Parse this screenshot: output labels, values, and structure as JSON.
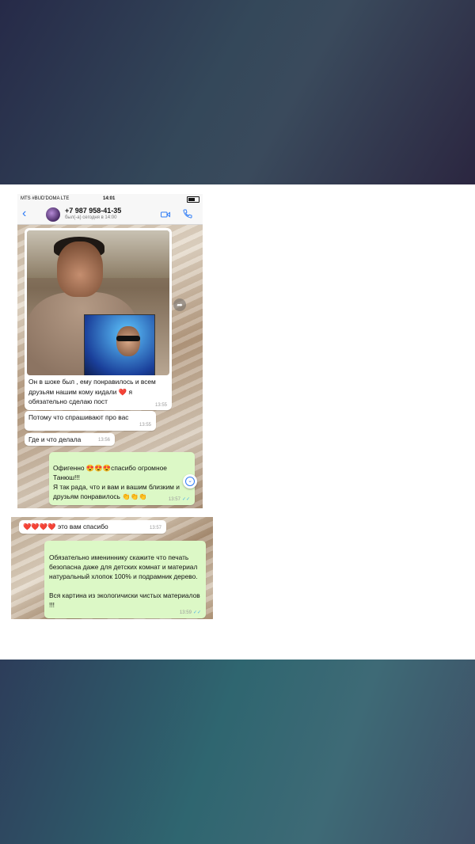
{
  "status_bar": {
    "carrier": "MTS #BUD'DOMA  LTE",
    "time": "14:01"
  },
  "chat_header": {
    "back_icon": "chevron-left-icon",
    "contact_name": "+7 987 958-41-35",
    "contact_status": "был(-а) сегодня в 14:00",
    "video_icon": "video-camera-icon",
    "phone_icon": "phone-icon"
  },
  "messages_1": [
    {
      "type": "incoming-photo",
      "text": "Он в шоке был , ему понравилось и всем друзьям нашим кому кидали ❤️ я обязательно сделаю пост",
      "time": "13:55"
    },
    {
      "type": "incoming",
      "text": "Потому что спрашивают про вас",
      "time": "13:55"
    },
    {
      "type": "incoming",
      "text": "Где и что делала",
      "time": "13:56"
    },
    {
      "type": "outgoing",
      "text": "Офигенно 😍😍😍спасибо огромное Танюш!!!\nЯ так рада, что и вам и вашим близким и друзьям понравилось 👏👏👏",
      "time": "13:57"
    }
  ],
  "messages_2": [
    {
      "type": "incoming",
      "text": "❤️❤️❤️❤️ это вам спасибо",
      "time": "13:57"
    },
    {
      "type": "outgoing",
      "text": "Обязательно имениннику скажите что печать безопасна даже для детских комнат  и материал натуральный хлопок 100% и подрамник дерево.\n\nВся картина из экологичиски чистых материалов !!!",
      "time": "13:59"
    }
  ],
  "colors": {
    "incoming_bubble": "#ffffff",
    "outgoing_bubble": "#dcf8c6",
    "accent": "#2f7cf6"
  }
}
